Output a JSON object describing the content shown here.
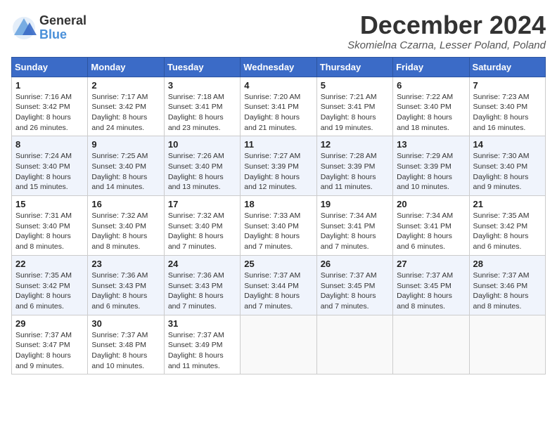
{
  "header": {
    "logo_general": "General",
    "logo_blue": "Blue",
    "title": "December 2024",
    "location": "Skomielna Czarna, Lesser Poland, Poland"
  },
  "weekdays": [
    "Sunday",
    "Monday",
    "Tuesday",
    "Wednesday",
    "Thursday",
    "Friday",
    "Saturday"
  ],
  "weeks": [
    [
      {
        "day": "1",
        "sunrise": "7:16 AM",
        "sunset": "3:42 PM",
        "daylight": "8 hours and 26 minutes."
      },
      {
        "day": "2",
        "sunrise": "7:17 AM",
        "sunset": "3:42 PM",
        "daylight": "8 hours and 24 minutes."
      },
      {
        "day": "3",
        "sunrise": "7:18 AM",
        "sunset": "3:41 PM",
        "daylight": "8 hours and 23 minutes."
      },
      {
        "day": "4",
        "sunrise": "7:20 AM",
        "sunset": "3:41 PM",
        "daylight": "8 hours and 21 minutes."
      },
      {
        "day": "5",
        "sunrise": "7:21 AM",
        "sunset": "3:41 PM",
        "daylight": "8 hours and 19 minutes."
      },
      {
        "day": "6",
        "sunrise": "7:22 AM",
        "sunset": "3:40 PM",
        "daylight": "8 hours and 18 minutes."
      },
      {
        "day": "7",
        "sunrise": "7:23 AM",
        "sunset": "3:40 PM",
        "daylight": "8 hours and 16 minutes."
      }
    ],
    [
      {
        "day": "8",
        "sunrise": "7:24 AM",
        "sunset": "3:40 PM",
        "daylight": "8 hours and 15 minutes."
      },
      {
        "day": "9",
        "sunrise": "7:25 AM",
        "sunset": "3:40 PM",
        "daylight": "8 hours and 14 minutes."
      },
      {
        "day": "10",
        "sunrise": "7:26 AM",
        "sunset": "3:40 PM",
        "daylight": "8 hours and 13 minutes."
      },
      {
        "day": "11",
        "sunrise": "7:27 AM",
        "sunset": "3:39 PM",
        "daylight": "8 hours and 12 minutes."
      },
      {
        "day": "12",
        "sunrise": "7:28 AM",
        "sunset": "3:39 PM",
        "daylight": "8 hours and 11 minutes."
      },
      {
        "day": "13",
        "sunrise": "7:29 AM",
        "sunset": "3:39 PM",
        "daylight": "8 hours and 10 minutes."
      },
      {
        "day": "14",
        "sunrise": "7:30 AM",
        "sunset": "3:40 PM",
        "daylight": "8 hours and 9 minutes."
      }
    ],
    [
      {
        "day": "15",
        "sunrise": "7:31 AM",
        "sunset": "3:40 PM",
        "daylight": "8 hours and 8 minutes."
      },
      {
        "day": "16",
        "sunrise": "7:32 AM",
        "sunset": "3:40 PM",
        "daylight": "8 hours and 8 minutes."
      },
      {
        "day": "17",
        "sunrise": "7:32 AM",
        "sunset": "3:40 PM",
        "daylight": "8 hours and 7 minutes."
      },
      {
        "day": "18",
        "sunrise": "7:33 AM",
        "sunset": "3:40 PM",
        "daylight": "8 hours and 7 minutes."
      },
      {
        "day": "19",
        "sunrise": "7:34 AM",
        "sunset": "3:41 PM",
        "daylight": "8 hours and 7 minutes."
      },
      {
        "day": "20",
        "sunrise": "7:34 AM",
        "sunset": "3:41 PM",
        "daylight": "8 hours and 6 minutes."
      },
      {
        "day": "21",
        "sunrise": "7:35 AM",
        "sunset": "3:42 PM",
        "daylight": "8 hours and 6 minutes."
      }
    ],
    [
      {
        "day": "22",
        "sunrise": "7:35 AM",
        "sunset": "3:42 PM",
        "daylight": "8 hours and 6 minutes."
      },
      {
        "day": "23",
        "sunrise": "7:36 AM",
        "sunset": "3:43 PM",
        "daylight": "8 hours and 6 minutes."
      },
      {
        "day": "24",
        "sunrise": "7:36 AM",
        "sunset": "3:43 PM",
        "daylight": "8 hours and 7 minutes."
      },
      {
        "day": "25",
        "sunrise": "7:37 AM",
        "sunset": "3:44 PM",
        "daylight": "8 hours and 7 minutes."
      },
      {
        "day": "26",
        "sunrise": "7:37 AM",
        "sunset": "3:45 PM",
        "daylight": "8 hours and 7 minutes."
      },
      {
        "day": "27",
        "sunrise": "7:37 AM",
        "sunset": "3:45 PM",
        "daylight": "8 hours and 8 minutes."
      },
      {
        "day": "28",
        "sunrise": "7:37 AM",
        "sunset": "3:46 PM",
        "daylight": "8 hours and 8 minutes."
      }
    ],
    [
      {
        "day": "29",
        "sunrise": "7:37 AM",
        "sunset": "3:47 PM",
        "daylight": "8 hours and 9 minutes."
      },
      {
        "day": "30",
        "sunrise": "7:37 AM",
        "sunset": "3:48 PM",
        "daylight": "8 hours and 10 minutes."
      },
      {
        "day": "31",
        "sunrise": "7:37 AM",
        "sunset": "3:49 PM",
        "daylight": "8 hours and 11 minutes."
      },
      null,
      null,
      null,
      null
    ]
  ]
}
